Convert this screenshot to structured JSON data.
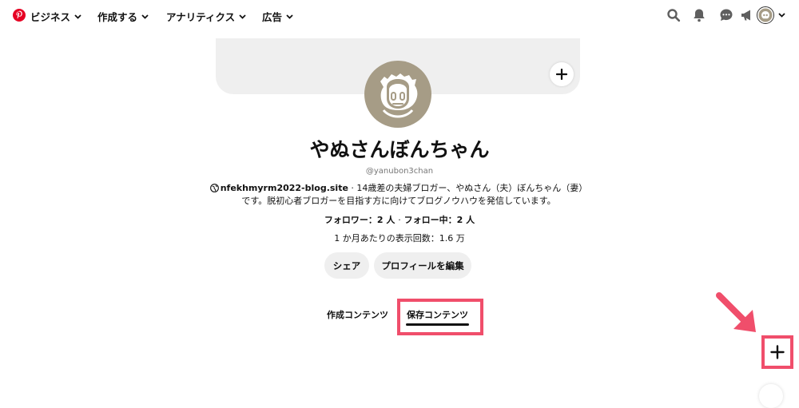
{
  "nav": {
    "business": "ビジネス",
    "create": "作成する",
    "analytics": "アナリティクス",
    "ads": "広告"
  },
  "icons": {
    "logo": "pinterest-logo-icon",
    "search": "search-icon",
    "notifications": "bell-icon",
    "messages": "chat-icon",
    "announcements": "megaphone-icon",
    "account": "avatar",
    "account_menu": "chevron-down-icon"
  },
  "colors": {
    "brand": "#e60023",
    "highlight": "#f04e6b",
    "avatar_bg": "#a69c86"
  },
  "profile": {
    "name": "やぬさんぼんちゃん",
    "username": "@yanubon3chan",
    "website": "nfekhmyrm2022-blog.site",
    "bio_line1": " · 14歳差の夫婦ブロガー、やぬさん（夫）ぼんちゃん（妻）",
    "bio_line2": "です。脱初心者ブロガーを目指す方に向けてブログノウハウを発信しています。",
    "followers": "フォロワー：2 人",
    "separator": "·",
    "following": "フォロー中：2 人",
    "monthly_views": "1 か月あたりの表示回数：1.6 万"
  },
  "buttons": {
    "share": "シェア",
    "edit_profile": "プロフィールを編集"
  },
  "tabs": {
    "created": "作成コンテンツ",
    "saved": "保存コンテンツ"
  }
}
